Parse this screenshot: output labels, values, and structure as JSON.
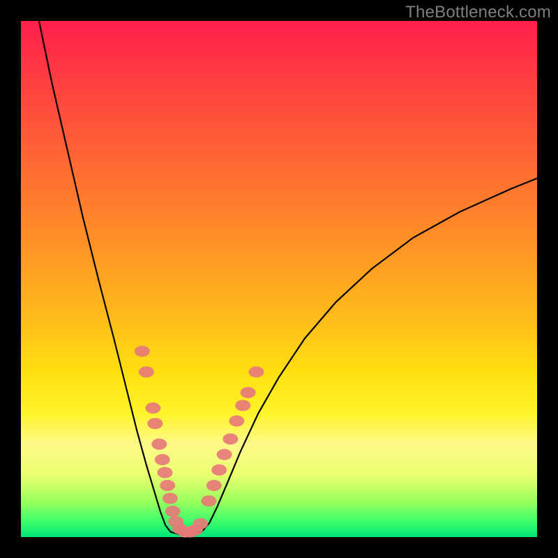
{
  "watermark": "TheBottleneck.com",
  "colors": {
    "frame": "#000000",
    "gradient_top": "#ff1f4b",
    "gradient_mid": "#ffe010",
    "gradient_bottom": "#00e47a",
    "curve": "#000000",
    "bead": "#e77a78"
  },
  "chart_data": {
    "type": "line",
    "title": "",
    "xlabel": "",
    "ylabel": "",
    "xlim": [
      0,
      100
    ],
    "ylim": [
      0,
      100
    ],
    "grid": false,
    "legend": false,
    "annotations": [],
    "series": [
      {
        "name": "left-branch",
        "x": [
          3.5,
          6,
          9,
          12,
          15,
          18,
          20.5,
          22.5,
          24.3,
          25.8,
          27,
          28,
          29
        ],
        "y": [
          100,
          88,
          75,
          62,
          50,
          38.5,
          28.5,
          20.5,
          14,
          9,
          5,
          2.3,
          1
        ]
      },
      {
        "name": "valley-floor",
        "x": [
          29,
          30.5,
          32,
          33.5,
          35
        ],
        "y": [
          1,
          0.6,
          0.6,
          0.6,
          1
        ]
      },
      {
        "name": "right-branch",
        "x": [
          35,
          36.5,
          38,
          40,
          42.5,
          46,
          50,
          55,
          61,
          68,
          76,
          85,
          95,
          100
        ],
        "y": [
          1,
          2.7,
          5.8,
          10.5,
          16.5,
          24,
          31,
          38.5,
          45.5,
          52,
          58,
          63,
          67.5,
          69.5
        ]
      }
    ],
    "markers": {
      "comment": "Highlighted bead-like markers clustered near the valley on both branches (approximate read-off of pink blobs).",
      "points": [
        {
          "x": 23.5,
          "y": 36
        },
        {
          "x": 24.3,
          "y": 32
        },
        {
          "x": 25.6,
          "y": 25
        },
        {
          "x": 26.0,
          "y": 22
        },
        {
          "x": 26.8,
          "y": 18
        },
        {
          "x": 27.4,
          "y": 15
        },
        {
          "x": 27.9,
          "y": 12.5
        },
        {
          "x": 28.4,
          "y": 10
        },
        {
          "x": 28.9,
          "y": 7.5
        },
        {
          "x": 29.4,
          "y": 5
        },
        {
          "x": 30.0,
          "y": 3
        },
        {
          "x": 30.8,
          "y": 1.6
        },
        {
          "x": 31.8,
          "y": 1.0
        },
        {
          "x": 32.8,
          "y": 1.0
        },
        {
          "x": 33.8,
          "y": 1.4
        },
        {
          "x": 34.8,
          "y": 2.6
        },
        {
          "x": 36.4,
          "y": 7
        },
        {
          "x": 37.4,
          "y": 10
        },
        {
          "x": 38.4,
          "y": 13
        },
        {
          "x": 39.4,
          "y": 16
        },
        {
          "x": 40.6,
          "y": 19
        },
        {
          "x": 41.8,
          "y": 22.5
        },
        {
          "x": 43.0,
          "y": 25.5
        },
        {
          "x": 44.0,
          "y": 28
        },
        {
          "x": 45.6,
          "y": 32
        }
      ]
    }
  }
}
